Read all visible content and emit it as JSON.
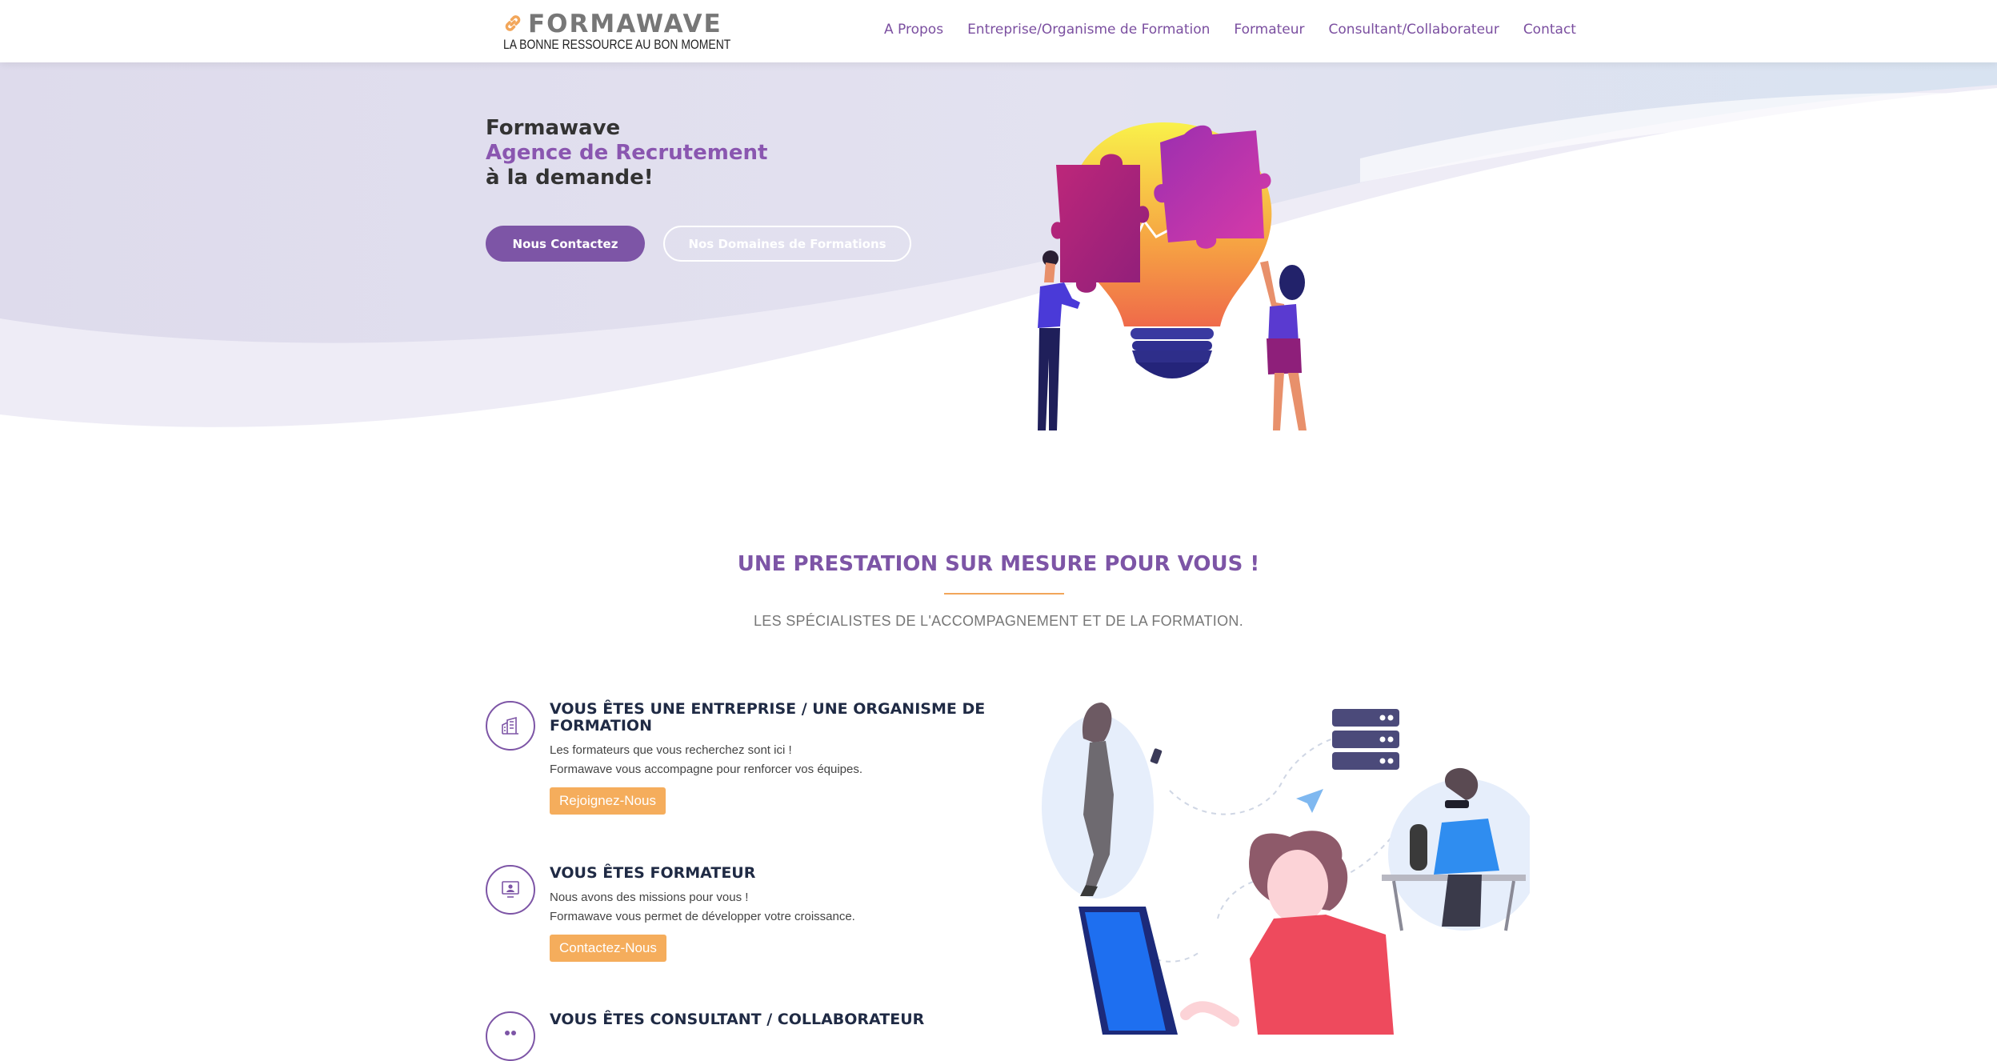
{
  "header": {
    "logo_word": "FORMAWAVE",
    "logo_tagline": "LA BONNE RESSOURCE AU BON MOMENT",
    "nav": [
      {
        "label": "A Propos"
      },
      {
        "label": "Entreprise/Organisme de Formation"
      },
      {
        "label": "Formateur"
      },
      {
        "label": "Consultant/Collaborateur"
      },
      {
        "label": "Contact"
      }
    ]
  },
  "hero": {
    "line1": "Formawave",
    "line2": "Agence de Recrutement",
    "line3": "à la demande!",
    "primary_button": "Nous Contactez",
    "secondary_button": "Nos Domaines de Formations"
  },
  "section": {
    "title": "UNE PRESTATION SUR MESURE POUR VOUS !",
    "subtitle": "LES SPÉCIALISTES DE L'ACCOMPAGNEMENT ET DE LA FORMATION."
  },
  "features": [
    {
      "icon": "building-icon",
      "title": "VOUS ÊTES UNE ENTREPRISE / UNE ORGANISME DE FORMATION",
      "line1": "Les formateurs que vous recherchez sont ici !",
      "line2": "Formawave vous accompagne pour renforcer vos équipes.",
      "button": "Rejoignez-Nous"
    },
    {
      "icon": "presenter-icon",
      "title": "VOUS ÊTES FORMATEUR",
      "line1": "Nous avons des missions pour vous !",
      "line2": "Formawave vous permet de développer votre croissance.",
      "button": "Contactez-Nous"
    },
    {
      "icon": "users-icon",
      "title": "VOUS ÊTES CONSULTANT / COLLABORATEUR"
    }
  ],
  "colors": {
    "brand_purple": "#7d55a6",
    "accent_orange": "#f5ad5c",
    "dark_navy": "#1f2a44"
  }
}
